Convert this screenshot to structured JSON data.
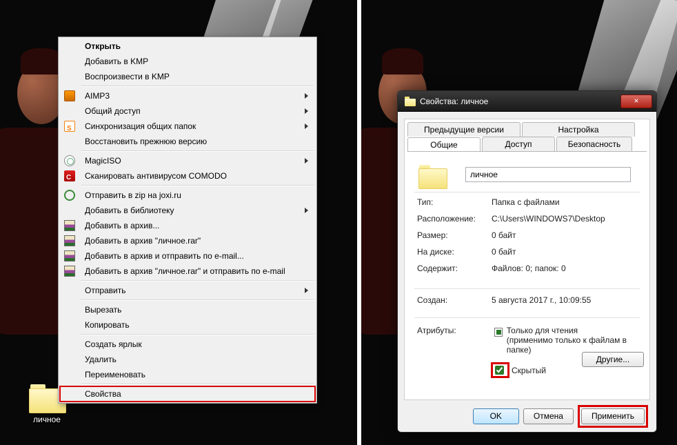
{
  "desktop": {
    "folder_label": "личное"
  },
  "context_menu": {
    "open": "Открыть",
    "add_kmp": "Добавить в KMP",
    "play_kmp": "Воспроизвести в KMP",
    "aimp": "AIMP3",
    "share": "Общий доступ",
    "sync": "Синхронизация общих папок",
    "restore": "Восстановить прежнюю версию",
    "magiciso": "MagicISO",
    "comodo": "Сканировать антивирусом COMODO",
    "joxi": "Отправить в zip на joxi.ru",
    "library": "Добавить в библиотеку",
    "add_archive": "Добавить в архив...",
    "add_rar": "Добавить в архив \"личное.rar\"",
    "add_email": "Добавить в архив и отправить по e-mail...",
    "add_rar_email": "Добавить в архив \"личное.rar\" и отправить по e-mail",
    "send": "Отправить",
    "cut": "Вырезать",
    "copy": "Копировать",
    "shortcut": "Создать ярлык",
    "delete": "Удалить",
    "rename": "Переименовать",
    "properties": "Свойства"
  },
  "dialog": {
    "title": "Свойства: личное",
    "close": "×",
    "tabs": {
      "prev": "Предыдущие версии",
      "settings": "Настройка",
      "general": "Общие",
      "access": "Доступ",
      "security": "Безопасность"
    },
    "folder_name": "личное",
    "props": {
      "type_k": "Тип:",
      "type_v": "Папка с файлами",
      "loc_k": "Расположение:",
      "loc_v": "C:\\Users\\WINDOWS7\\Desktop",
      "size_k": "Размер:",
      "size_v": "0 байт",
      "ondisk_k": "На диске:",
      "ondisk_v": "0 байт",
      "contains_k": "Содержит:",
      "contains_v": "Файлов: 0; папок: 0",
      "created_k": "Создан:",
      "created_v": "5 августа 2017 г., 10:09:55",
      "attr_k": "Атрибуты:",
      "readonly": "Только для чтения",
      "readonly_note": "(применимо только к файлам в папке)",
      "hidden": "Скрытый",
      "other": "Другие..."
    },
    "buttons": {
      "ok": "OK",
      "cancel": "Отмена",
      "apply": "Применить"
    }
  }
}
